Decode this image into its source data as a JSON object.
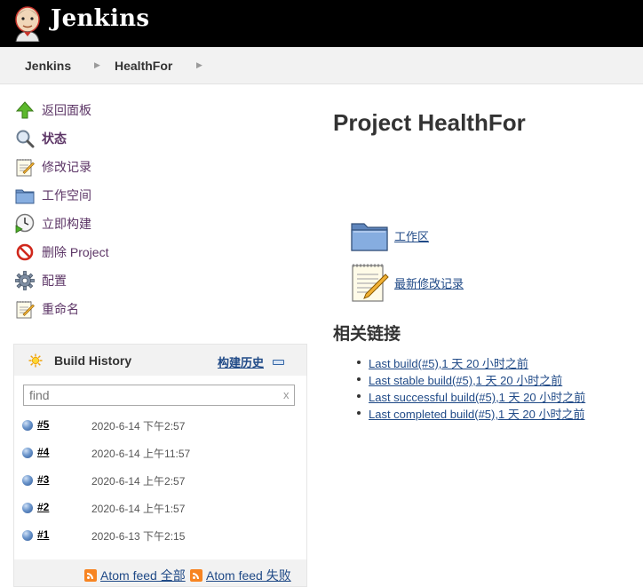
{
  "header": {
    "brand": "Jenkins",
    "logo_icon": "jenkins-butler-logo"
  },
  "breadcrumb": [
    {
      "label": "Jenkins"
    },
    {
      "label": "HealthFor"
    }
  ],
  "tasks": [
    {
      "label": "返回面板",
      "icon": "up-arrow-icon",
      "bold": false
    },
    {
      "label": "状态",
      "icon": "search-icon",
      "bold": true
    },
    {
      "label": "修改记录",
      "icon": "notepad-icon",
      "bold": false
    },
    {
      "label": "工作空间",
      "icon": "folder-icon",
      "bold": false
    },
    {
      "label": "立即构建",
      "icon": "clock-build-icon",
      "bold": false
    },
    {
      "label": "删除 Project",
      "icon": "no-entry-icon",
      "bold": false
    },
    {
      "label": "配置",
      "icon": "gear-icon",
      "bold": false
    },
    {
      "label": "重命名",
      "icon": "notepad-icon",
      "bold": false
    }
  ],
  "build_history": {
    "title": "Build History",
    "trend_label": "构建历史",
    "search_placeholder": "find",
    "search_clear": "x",
    "builds": [
      {
        "number": "#5",
        "date": "2020-6-14 下午2:57"
      },
      {
        "number": "#4",
        "date": "2020-6-14 上午11:57"
      },
      {
        "number": "#3",
        "date": "2020-6-14 上午2:57"
      },
      {
        "number": "#2",
        "date": "2020-6-14 上午1:57"
      },
      {
        "number": "#1",
        "date": "2020-6-13 下午2:15"
      }
    ],
    "feeds": [
      {
        "label": "Atom feed 全部"
      },
      {
        "label": "Atom feed 失败"
      }
    ]
  },
  "main": {
    "title": "Project HealthFor",
    "workspace_link": "工作区",
    "changes_link": "最新修改记录",
    "related_title": "相关链接",
    "related_links": [
      "Last build(#5),1 天 20 小时之前",
      "Last stable build(#5),1 天 20 小时之前",
      "Last successful build(#5),1 天 20 小时之前",
      "Last completed build(#5),1 天 20 小时之前"
    ]
  },
  "colors": {
    "header_bg": "#000000",
    "link": "#204a87",
    "task_text": "#5c3566",
    "panel_bg": "#f2f2f2"
  }
}
